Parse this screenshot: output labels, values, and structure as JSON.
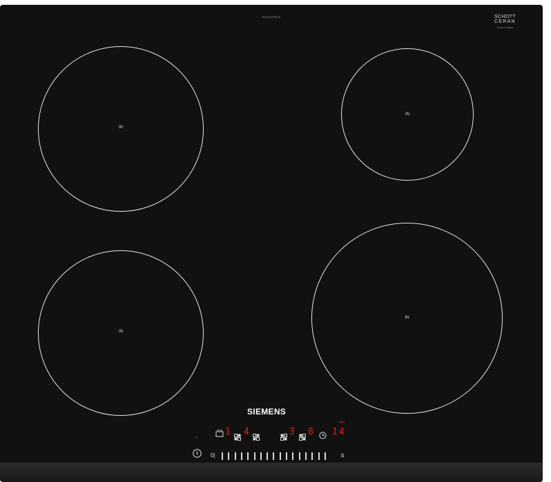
{
  "model_code": "EU631FEB1E",
  "schott": {
    "line1": "SCHOTT",
    "line2": "CERAN",
    "line3": "SCHOTT CERAN"
  },
  "zones": {
    "front_left": "IN",
    "back_right": "IN",
    "rear_left": "IN",
    "front_right": "IN"
  },
  "brand": "SIEMENS",
  "display": {
    "pot_icon": "pot-icon",
    "zone_digit_1": "1",
    "zone_digit_2": "4",
    "zone_digit_3": "3",
    "zone_digit_4": "8",
    "timer_digits": "14",
    "timer_unit": "min",
    "power_indicator": "•"
  },
  "controls": {
    "power_icon": "power-icon",
    "slider_start": "0|",
    "slider_end": "b",
    "slider_tick_count": 17
  },
  "colors": {
    "glass": "#111111",
    "zone_outline": "#e8e8e8",
    "display_red": "#e0201c"
  }
}
